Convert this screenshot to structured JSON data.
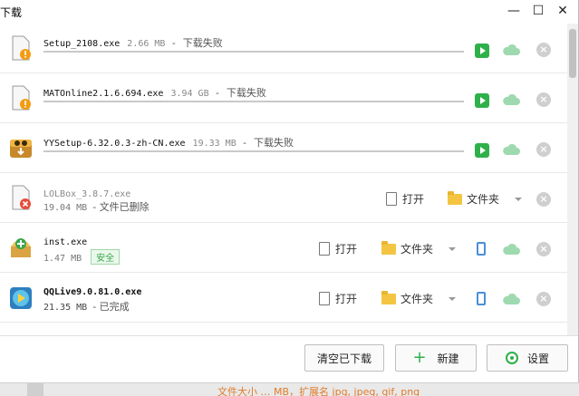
{
  "window": {
    "title": "下载"
  },
  "titlebar": {
    "minimize": "—",
    "maximize": "☐",
    "close": "✕"
  },
  "downloads": [
    {
      "name": "Setup_2108.exe",
      "size": "2.66 MB",
      "status": "- 下载失败"
    },
    {
      "name": "MATOnline2.1.6.694.exe",
      "size": "3.94 GB",
      "status": "- 下载失败"
    },
    {
      "name": "YYSetup-6.32.0.3-zh-CN.exe",
      "size": "19.33 MB",
      "status": "- 下载失败"
    },
    {
      "name": "LOLBox_3.8.7.exe",
      "size": "19.04 MB",
      "status": "- 文件已删除",
      "open": "打开",
      "folder": "文件夹"
    },
    {
      "name": "inst.exe",
      "size": "1.47 MB",
      "badge": "安全",
      "open": "打开",
      "folder": "文件夹"
    },
    {
      "name": "QQLive9.0.81.0.exe",
      "size": "21.35 MB",
      "status": "- 已完成",
      "open": "打开",
      "folder": "文件夹"
    }
  ],
  "footer": {
    "clear_label": "清空已下载",
    "new_label": "新建",
    "settings_label": "设置"
  },
  "background": {
    "text": "文件大小 … MB，扩展名 jpg, jpeg, gif, png"
  },
  "colors": {
    "accent_green": "#2fb04a",
    "folder_yellow": "#f3c542",
    "fail_orange": "#f39c12"
  }
}
